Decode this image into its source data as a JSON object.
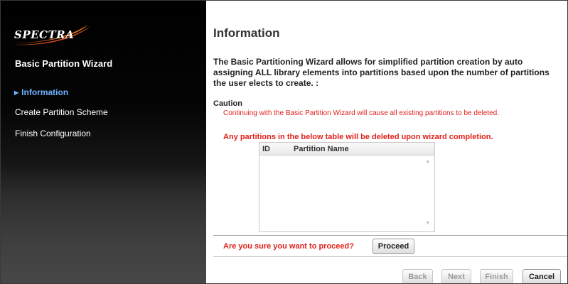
{
  "sidebar": {
    "logo_text": "SPECTRA",
    "title": "Basic Partition Wizard",
    "items": [
      {
        "label": "Information",
        "active": true
      },
      {
        "label": "Create Partition Scheme",
        "active": false
      },
      {
        "label": "Finish Configuration",
        "active": false
      }
    ]
  },
  "main": {
    "title": "Information",
    "intro": "The Basic Partitioning Wizard allows for simplified partition creation by auto assigning ALL library elements into partitions based upon the number of partitions the user elects to create. :",
    "caution_label": "Caution",
    "caution_text": "Continuing with the Basic Partition Wizard will cause all existing partitions to be deleted.",
    "warning": "Any partitions in the below table will be deleted upon wizard completion.",
    "table": {
      "columns": [
        "ID",
        "Partition Name"
      ],
      "rows": []
    },
    "proceed_question": "Are you sure you want to proceed?",
    "proceed_label": "Proceed"
  },
  "footer": {
    "back_label": "Back",
    "next_label": "Next",
    "finish_label": "Finish",
    "cancel_label": "Cancel"
  },
  "colors": {
    "accent_active": "#6fb3ff",
    "warning": "#e0201b",
    "logo_swoosh": "#e8701a"
  }
}
